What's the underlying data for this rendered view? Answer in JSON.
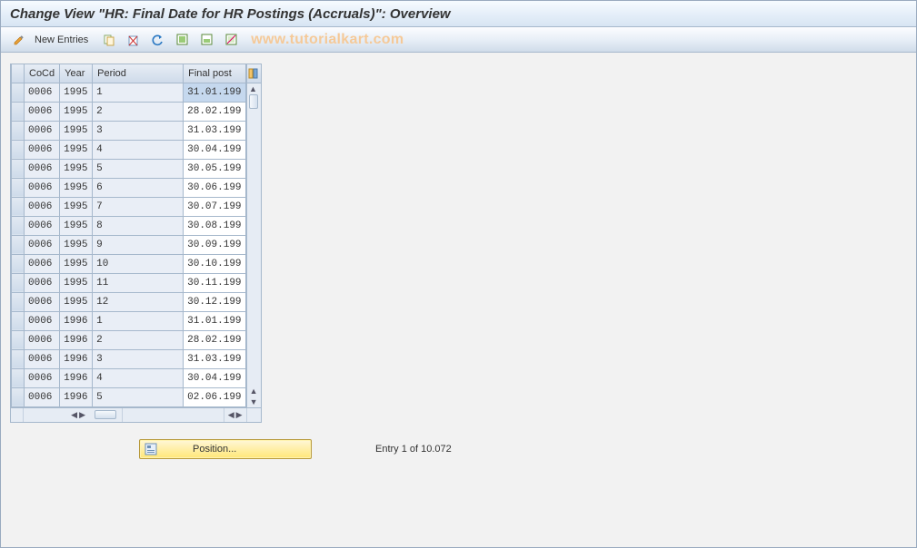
{
  "title": "Change View \"HR: Final Date for HR Postings (Accruals)\": Overview",
  "toolbar": {
    "new_entries": "New Entries"
  },
  "watermark": "www.tutorialkart.com",
  "table": {
    "headers": {
      "cocd": "CoCd",
      "year": "Year",
      "period": "Period",
      "finalpost": "Final post"
    },
    "rows": [
      {
        "cocd": "0006",
        "year": "1995",
        "period": "1",
        "finalpost": "31.01.199"
      },
      {
        "cocd": "0006",
        "year": "1995",
        "period": "2",
        "finalpost": "28.02.199"
      },
      {
        "cocd": "0006",
        "year": "1995",
        "period": "3",
        "finalpost": "31.03.199"
      },
      {
        "cocd": "0006",
        "year": "1995",
        "period": "4",
        "finalpost": "30.04.199"
      },
      {
        "cocd": "0006",
        "year": "1995",
        "period": "5",
        "finalpost": "30.05.199"
      },
      {
        "cocd": "0006",
        "year": "1995",
        "period": "6",
        "finalpost": "30.06.199"
      },
      {
        "cocd": "0006",
        "year": "1995",
        "period": "7",
        "finalpost": "30.07.199"
      },
      {
        "cocd": "0006",
        "year": "1995",
        "period": "8",
        "finalpost": "30.08.199"
      },
      {
        "cocd": "0006",
        "year": "1995",
        "period": "9",
        "finalpost": "30.09.199"
      },
      {
        "cocd": "0006",
        "year": "1995",
        "period": "10",
        "finalpost": "30.10.199"
      },
      {
        "cocd": "0006",
        "year": "1995",
        "period": "11",
        "finalpost": "30.11.199"
      },
      {
        "cocd": "0006",
        "year": "1995",
        "period": "12",
        "finalpost": "30.12.199"
      },
      {
        "cocd": "0006",
        "year": "1996",
        "period": "1",
        "finalpost": "31.01.199"
      },
      {
        "cocd": "0006",
        "year": "1996",
        "period": "2",
        "finalpost": "28.02.199"
      },
      {
        "cocd": "0006",
        "year": "1996",
        "period": "3",
        "finalpost": "31.03.199"
      },
      {
        "cocd": "0006",
        "year": "1996",
        "period": "4",
        "finalpost": "30.04.199"
      },
      {
        "cocd": "0006",
        "year": "1996",
        "period": "5",
        "finalpost": "02.06.199"
      }
    ]
  },
  "footer": {
    "position_label": "Position...",
    "entry_text": "Entry 1 of 10.072"
  }
}
